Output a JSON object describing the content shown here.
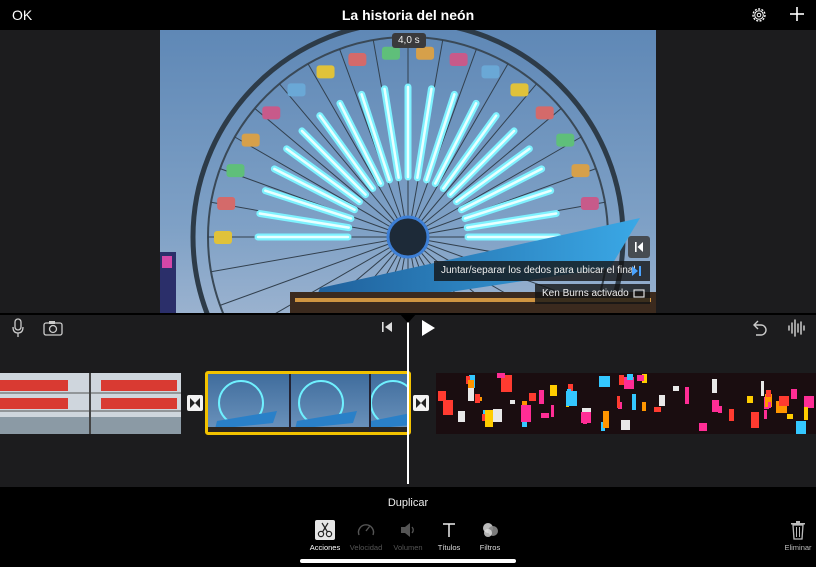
{
  "topbar": {
    "done_label": "OK",
    "project_title": "La historia del neón",
    "settings_icon": "gear-icon",
    "add_icon": "plus-icon"
  },
  "viewer": {
    "clip_duration": "4,0 s",
    "hint_text": "Juntar/separar los dedos para ubicar el final",
    "ken_burns_text": "Ken Burns activado"
  },
  "timeline": {
    "clips": [
      "public-market-clip",
      "ferris-wheel-clip",
      "neon-street-clip"
    ],
    "selected_clip": "ferris-wheel-clip"
  },
  "bottom": {
    "selected_action": "Duplicar",
    "tools": [
      {
        "label": "Acciones",
        "icon": "scissors-icon",
        "active": true
      },
      {
        "label": "Velocidad",
        "icon": "speedometer-icon",
        "active": false
      },
      {
        "label": "Volumen",
        "icon": "speaker-icon",
        "active": false
      },
      {
        "label": "Títulos",
        "icon": "text-icon",
        "active": true
      },
      {
        "label": "Filtros",
        "icon": "filters-icon",
        "active": true
      }
    ],
    "delete_label": "Eliminar"
  },
  "colors": {
    "selection": "#f2c200",
    "accent": "#4aa3ff",
    "background": "#1c1c1e"
  }
}
